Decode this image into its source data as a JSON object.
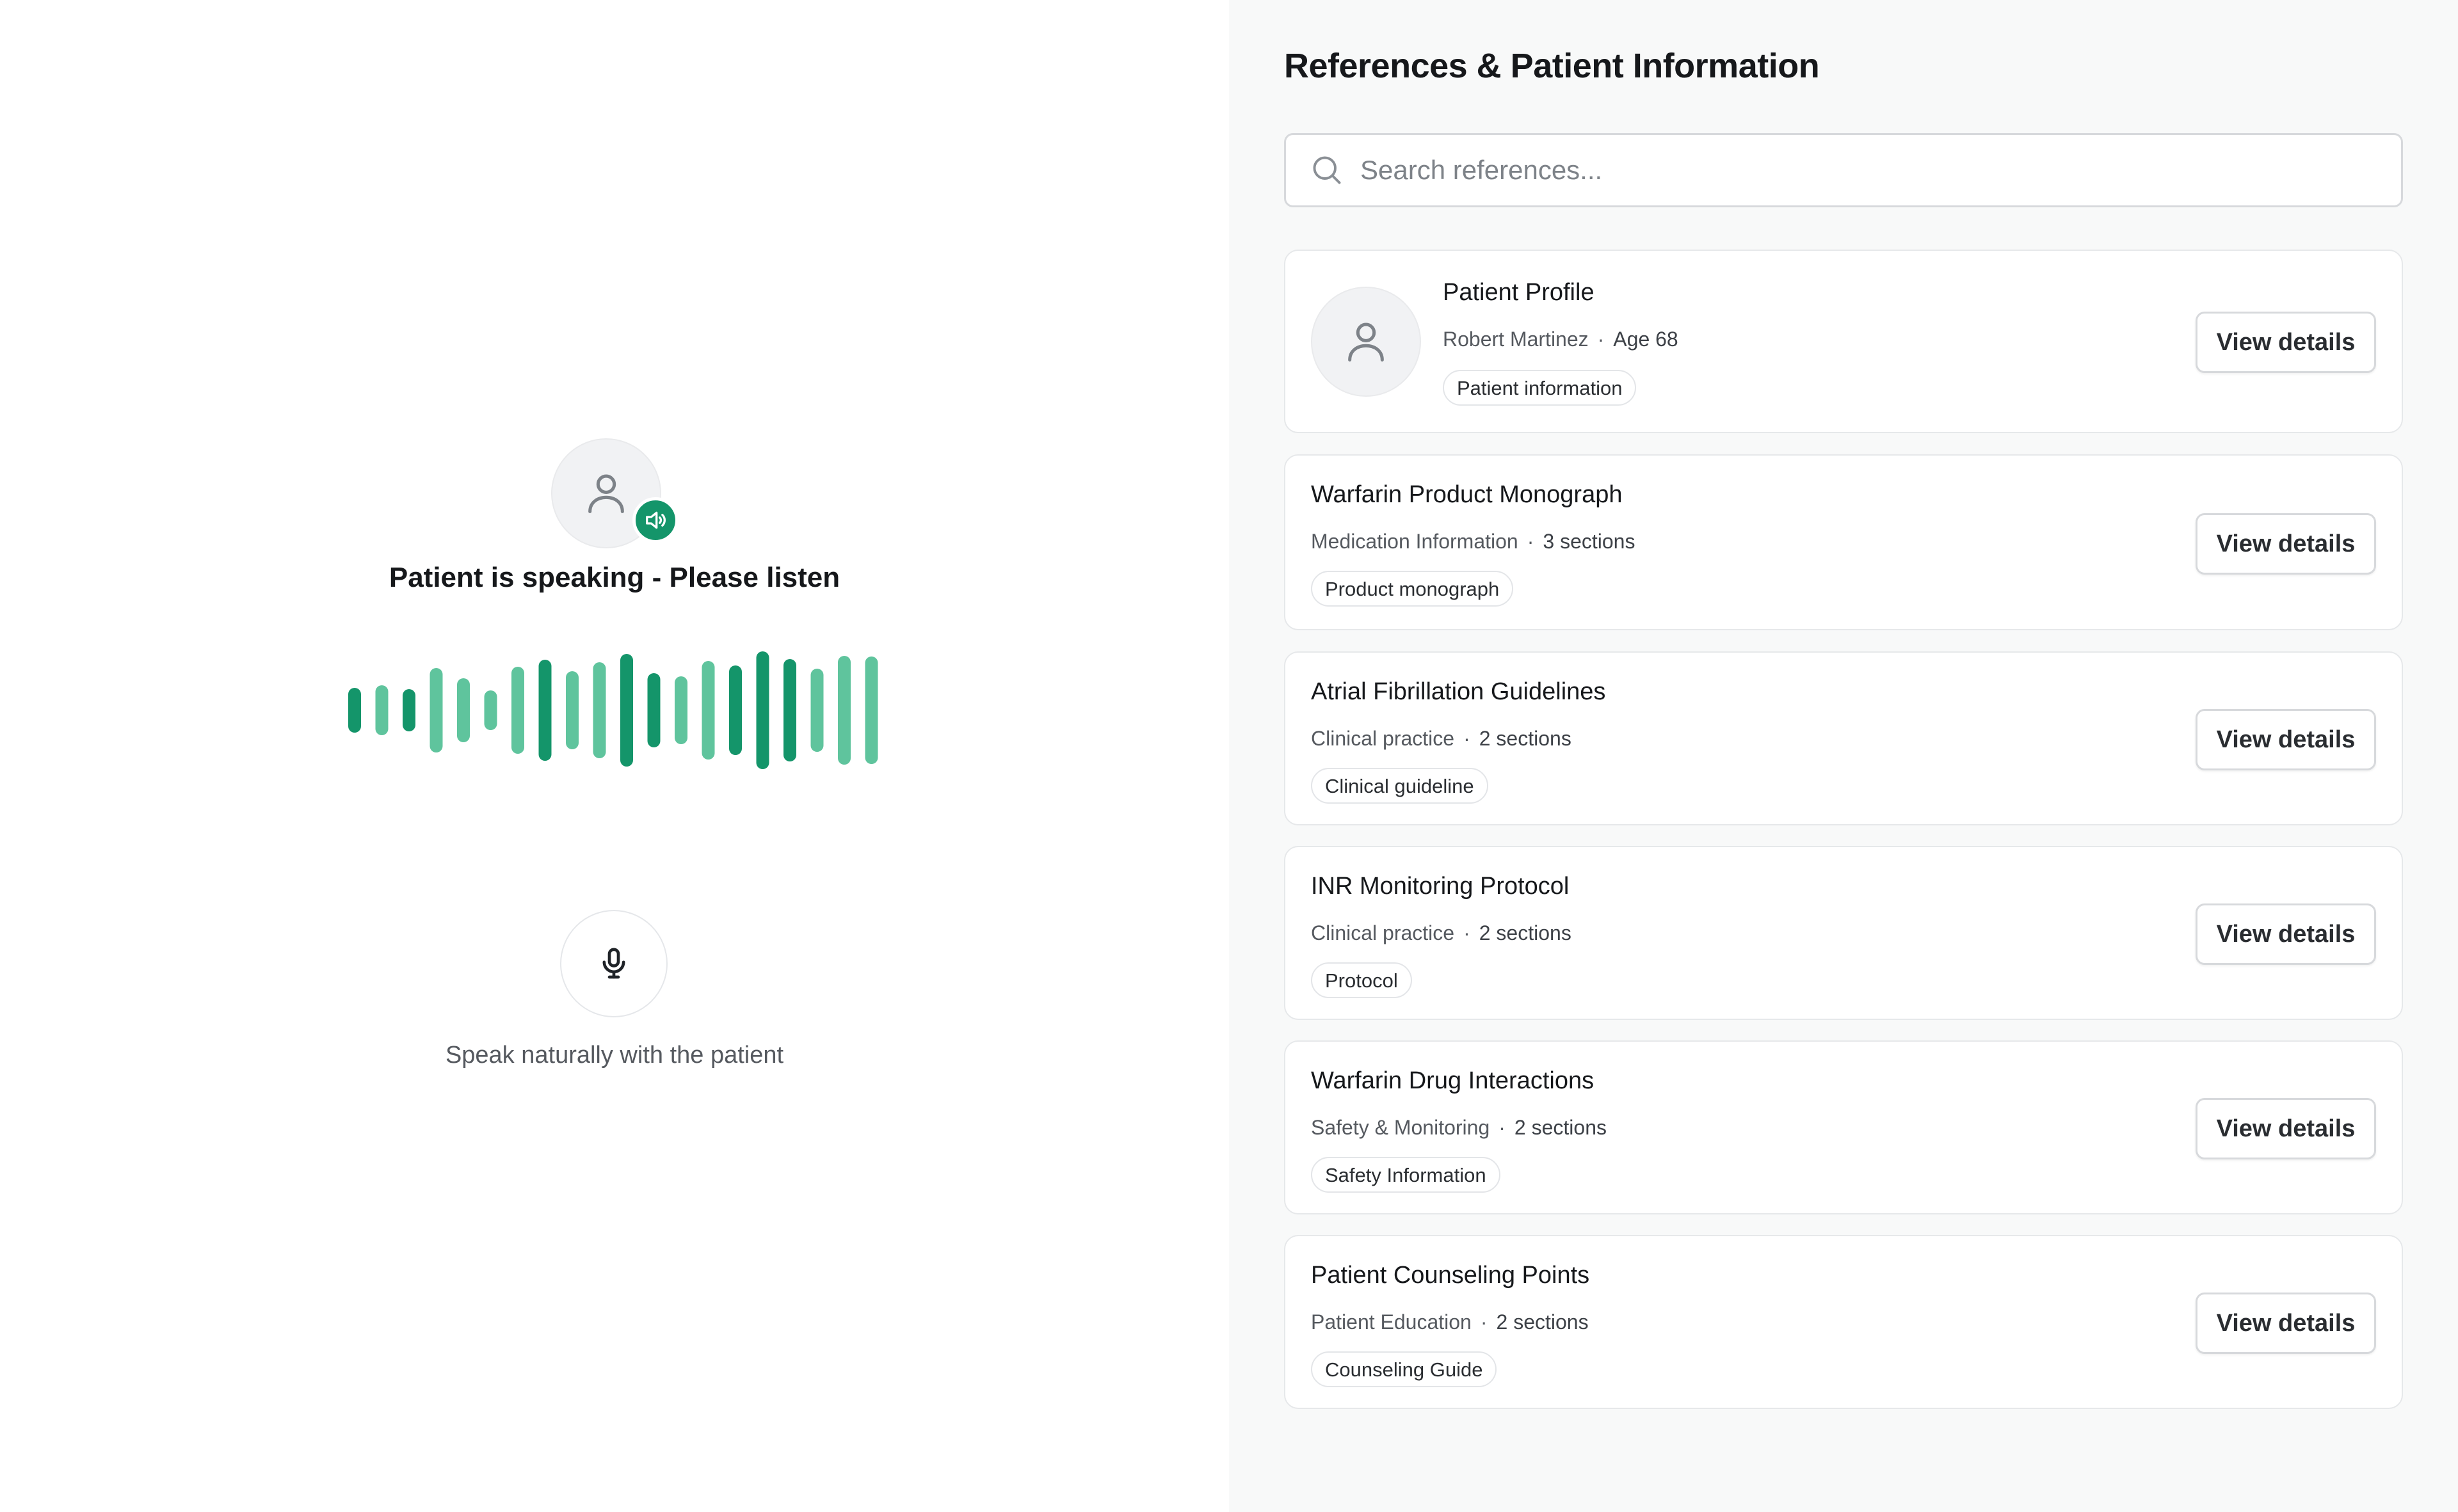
{
  "left": {
    "speaking_title": "Patient is speaking - Please listen",
    "hint": "Speak naturally with the patient",
    "accent": "#14956a",
    "wave_light": "#5fc49d",
    "icons": {
      "avatar": "user-icon",
      "badge": "speaker-icon",
      "mic": "microphone-icon"
    }
  },
  "right": {
    "title": "References & Patient Information",
    "search": {
      "placeholder": "Search references...",
      "value": ""
    },
    "view_label": "View details",
    "profile": {
      "title": "Patient Profile",
      "name": "Robert Martinez",
      "age": "Age 68",
      "tag": "Patient information"
    },
    "references": [
      {
        "title": "Warfarin Product Monograph",
        "category": "Medication Information",
        "count": "3 sections",
        "tag": "Product monograph"
      },
      {
        "title": "Atrial Fibrillation Guidelines",
        "category": "Clinical practice",
        "count": "2 sections",
        "tag": "Clinical guideline"
      },
      {
        "title": "INR Monitoring Protocol",
        "category": "Clinical practice",
        "count": "2 sections",
        "tag": "Protocol"
      },
      {
        "title": "Warfarin Drug Interactions",
        "category": "Safety & Monitoring",
        "count": "2 sections",
        "tag": "Safety Information"
      },
      {
        "title": "Patient Counseling Points",
        "category": "Patient Education",
        "count": "2 sections",
        "tag": "Counseling Guide"
      }
    ]
  }
}
